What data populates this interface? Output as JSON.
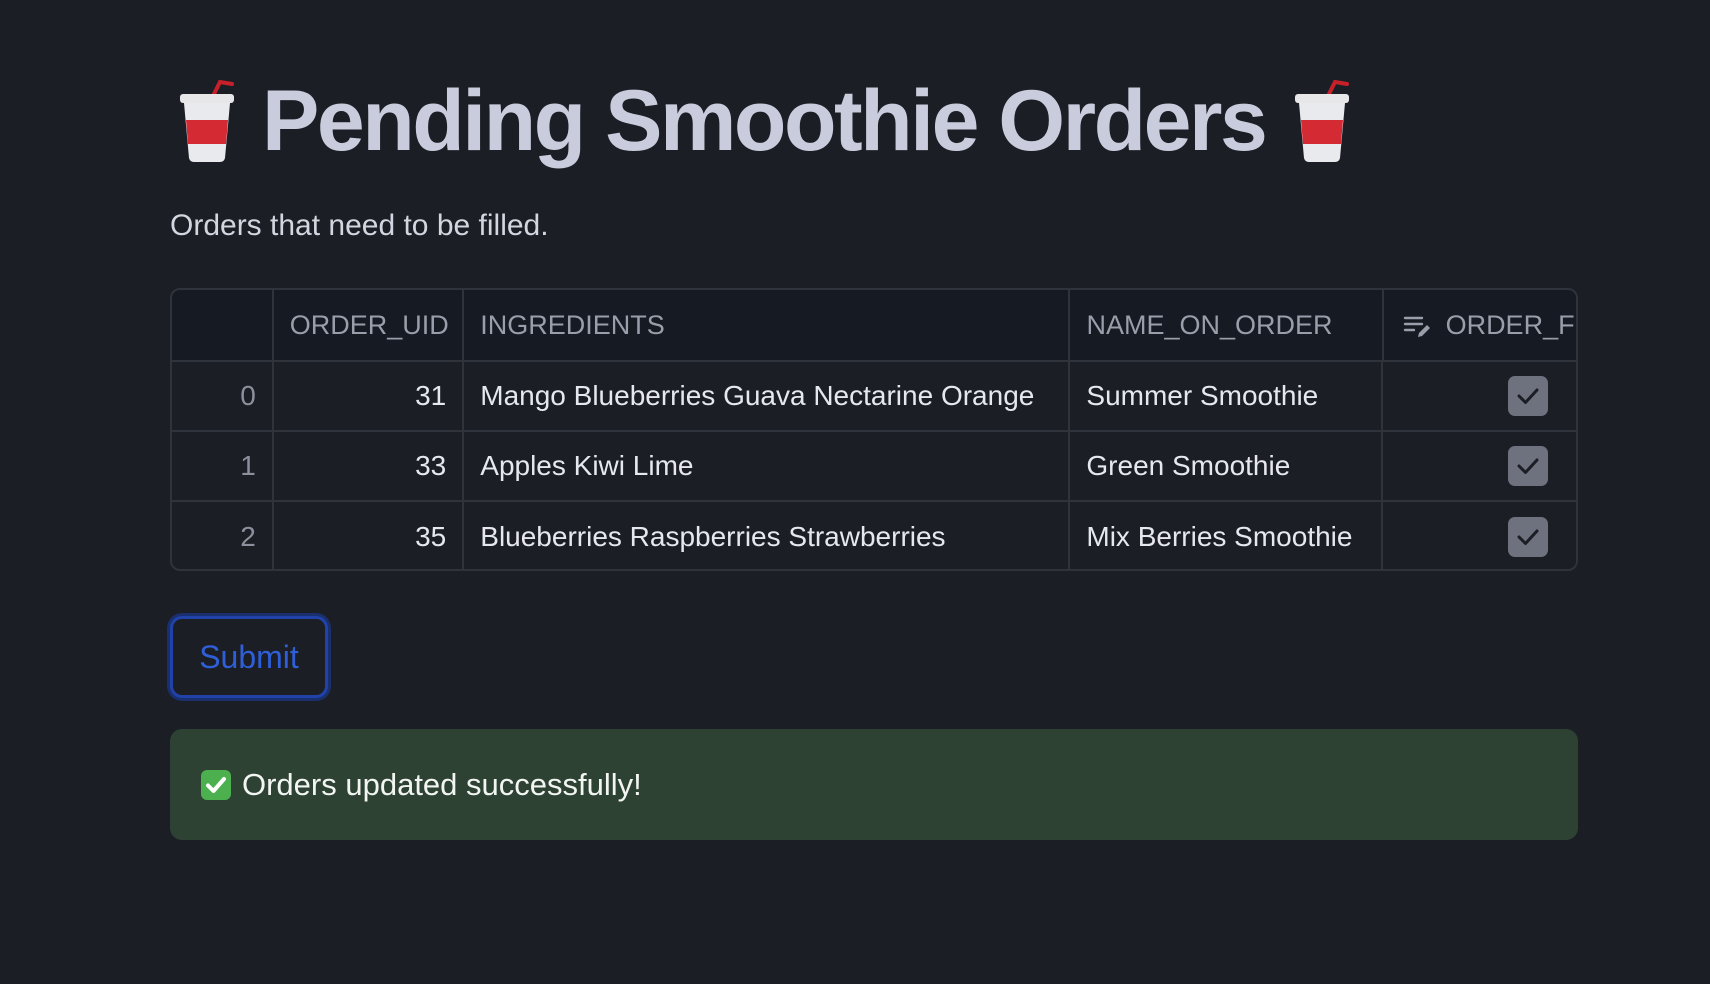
{
  "title": {
    "text": "Pending Smoothie Orders",
    "icon_left": "cup-with-straw-icon",
    "icon_right": "cup-with-straw-icon"
  },
  "subtitle": "Orders that need to be filled.",
  "table": {
    "columns": [
      "",
      "ORDER_UID",
      "INGREDIENTS",
      "NAME_ON_ORDER",
      "ORDER_FI"
    ],
    "editable_column_icon": "edit-column-icon",
    "rows": [
      {
        "index": "0",
        "order_uid": "31",
        "ingredients": "Mango Blueberries Guava Nectarine Orange",
        "name_on_order": "Summer Smoothie",
        "order_filled": true
      },
      {
        "index": "1",
        "order_uid": "33",
        "ingredients": "Apples Kiwi Lime",
        "name_on_order": "Green Smoothie",
        "order_filled": true
      },
      {
        "index": "2",
        "order_uid": "35",
        "ingredients": "Blueberries Raspberries Strawberries",
        "name_on_order": "Mix Berries Smoothie",
        "order_filled": true
      }
    ]
  },
  "submit_button": {
    "label": "Submit"
  },
  "alert": {
    "text": "Orders updated successfully!",
    "icon": "check-mark-button-icon"
  },
  "colors": {
    "background": "#1b1e24",
    "title": "#c9ccdc",
    "accent": "#2f5fd8",
    "success_bg": "#2d4233"
  }
}
